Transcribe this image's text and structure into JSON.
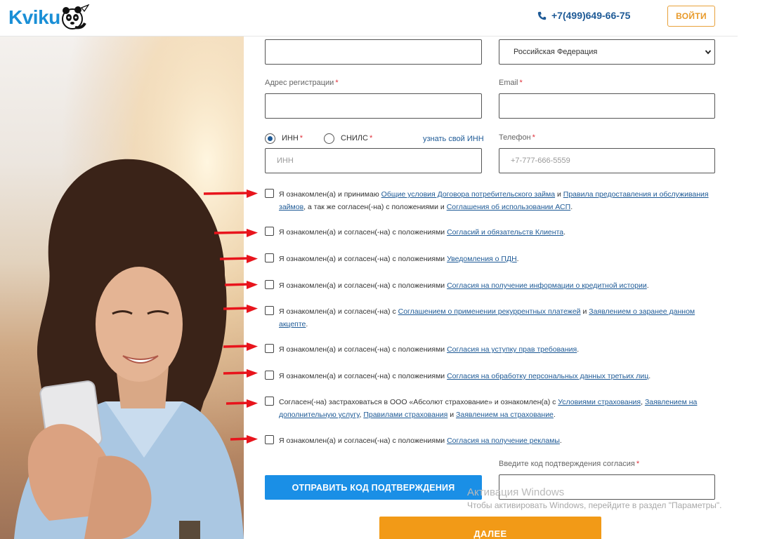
{
  "header": {
    "logo_text": "Kviku",
    "phone": "+7(499)649-66-75",
    "login_label": "ВОЙТИ"
  },
  "form": {
    "country_select": {
      "value": "Российская Федерация"
    },
    "address": {
      "label": "Адрес регистрации",
      "required": "*"
    },
    "email": {
      "label": "Email",
      "required": "*"
    },
    "id_type": {
      "inn_label": "ИНН",
      "snils_label": "СНИЛС",
      "required": "*",
      "inn_link": "узнать свой ИНН",
      "selected": "inn"
    },
    "inn_input": {
      "placeholder": "ИНН"
    },
    "phone": {
      "label": "Телефон",
      "required": "*",
      "placeholder": "+7-777-666-5559"
    },
    "consents": [
      {
        "parts": [
          "Я ознакомлен(а) и принимаю ",
          {
            "link": "Общие условия Договора потребительского займа"
          },
          " и ",
          {
            "link": "Правила предоставления и обслуживания займов"
          },
          ", а так же согласен(-на) с положениями и ",
          {
            "link": "Соглашения об использовании АСП"
          },
          "."
        ]
      },
      {
        "parts": [
          "Я ознакомлен(а) и согласен(-на) с положениями ",
          {
            "link": "Согласий и обязательств Клиента"
          },
          "."
        ]
      },
      {
        "parts": [
          "Я ознакомлен(а) и согласен(-на) с положениями ",
          {
            "link": "Уведомления о ПДН"
          },
          "."
        ]
      },
      {
        "parts": [
          "Я ознакомлен(а) и согласен(-на) с положениями ",
          {
            "link": "Согласия на получение информации о кредитной истории"
          },
          "."
        ]
      },
      {
        "parts": [
          "Я ознакомлен(а) и согласен(-на) с ",
          {
            "link": "Соглашением о применении рекуррентных платежей"
          },
          " и ",
          {
            "link": "Заявлением о заранее данном акцепте"
          },
          "."
        ]
      },
      {
        "parts": [
          "Я ознакомлен(а) и согласен(-на) с положениями ",
          {
            "link": "Согласия на уступку прав требования"
          },
          "."
        ]
      },
      {
        "parts": [
          "Я ознакомлен(а) и согласен(-на) с положениями ",
          {
            "link": "Согласия на обработку персональных данных третьих лиц"
          },
          "."
        ]
      },
      {
        "parts": [
          "Согласен(-на) застраховаться в ООО «Абсолют страхование» и ознакомлен(а) с ",
          {
            "link": "Условиями страхования"
          },
          ", ",
          {
            "link": "Заявлением на дополнительную услугу"
          },
          ", ",
          {
            "link": "Правилами страхования"
          },
          " и ",
          {
            "link": "Заявлением на страхование"
          },
          "."
        ]
      },
      {
        "parts": [
          "Я ознакомлен(а) и согласен(-на) с положениями ",
          {
            "link": "Согласия на получение рекламы"
          },
          "."
        ]
      }
    ],
    "code": {
      "label": "Введите код подтверждения согласия",
      "required": "*"
    },
    "send_code_label": "ОТПРАВИТЬ КОД ПОДТВЕРЖДЕНИЯ",
    "next_label": "ДАЛЕЕ"
  },
  "windows_overlay": {
    "title": "Активация Windows",
    "subtitle": "Чтобы активировать Windows, перейдите в раздел \"Параметры\"."
  },
  "colors": {
    "brand_blue": "#1a8fd6",
    "link_blue": "#1e5a96",
    "button_blue": "#1a8fe6",
    "orange": "#f29a17",
    "required_red": "#e0303a",
    "arrow_red": "#e8141c"
  }
}
